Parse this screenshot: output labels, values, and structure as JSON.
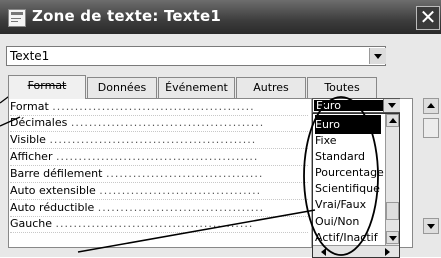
{
  "window": {
    "title": "Zone de texte: Texte1",
    "close_glyph": "✕"
  },
  "object_select": {
    "value": "Texte1"
  },
  "tabs": [
    {
      "label": "Format",
      "active": true
    },
    {
      "label": "Données"
    },
    {
      "label": "Événement"
    },
    {
      "label": "Autres"
    },
    {
      "label": "Toutes"
    }
  ],
  "properties": [
    {
      "label": "Format"
    },
    {
      "label": "Décimales"
    },
    {
      "label": "Visible"
    },
    {
      "label": "Afficher"
    },
    {
      "label": "Barre défilement"
    },
    {
      "label": "Auto extensible"
    },
    {
      "label": "Auto réductible"
    },
    {
      "label": "Gauche"
    }
  ],
  "format_combo": {
    "value": "Euro"
  },
  "dropdown": {
    "items": [
      "Euro",
      "Fixe",
      "Standard",
      "Pourcentage",
      "Scientifique",
      "Vrai/Faux",
      "Oui/Non",
      "Actif/Inactif"
    ],
    "selected_index": 0
  },
  "icons": {
    "window_icon": "form-icon",
    "close": "close-icon",
    "dropdown_arrow": "chevron-down-icon"
  },
  "colors": {
    "titlebar": "#3d3d3d",
    "selection": "#000000",
    "panel": "#e8e8e8"
  }
}
